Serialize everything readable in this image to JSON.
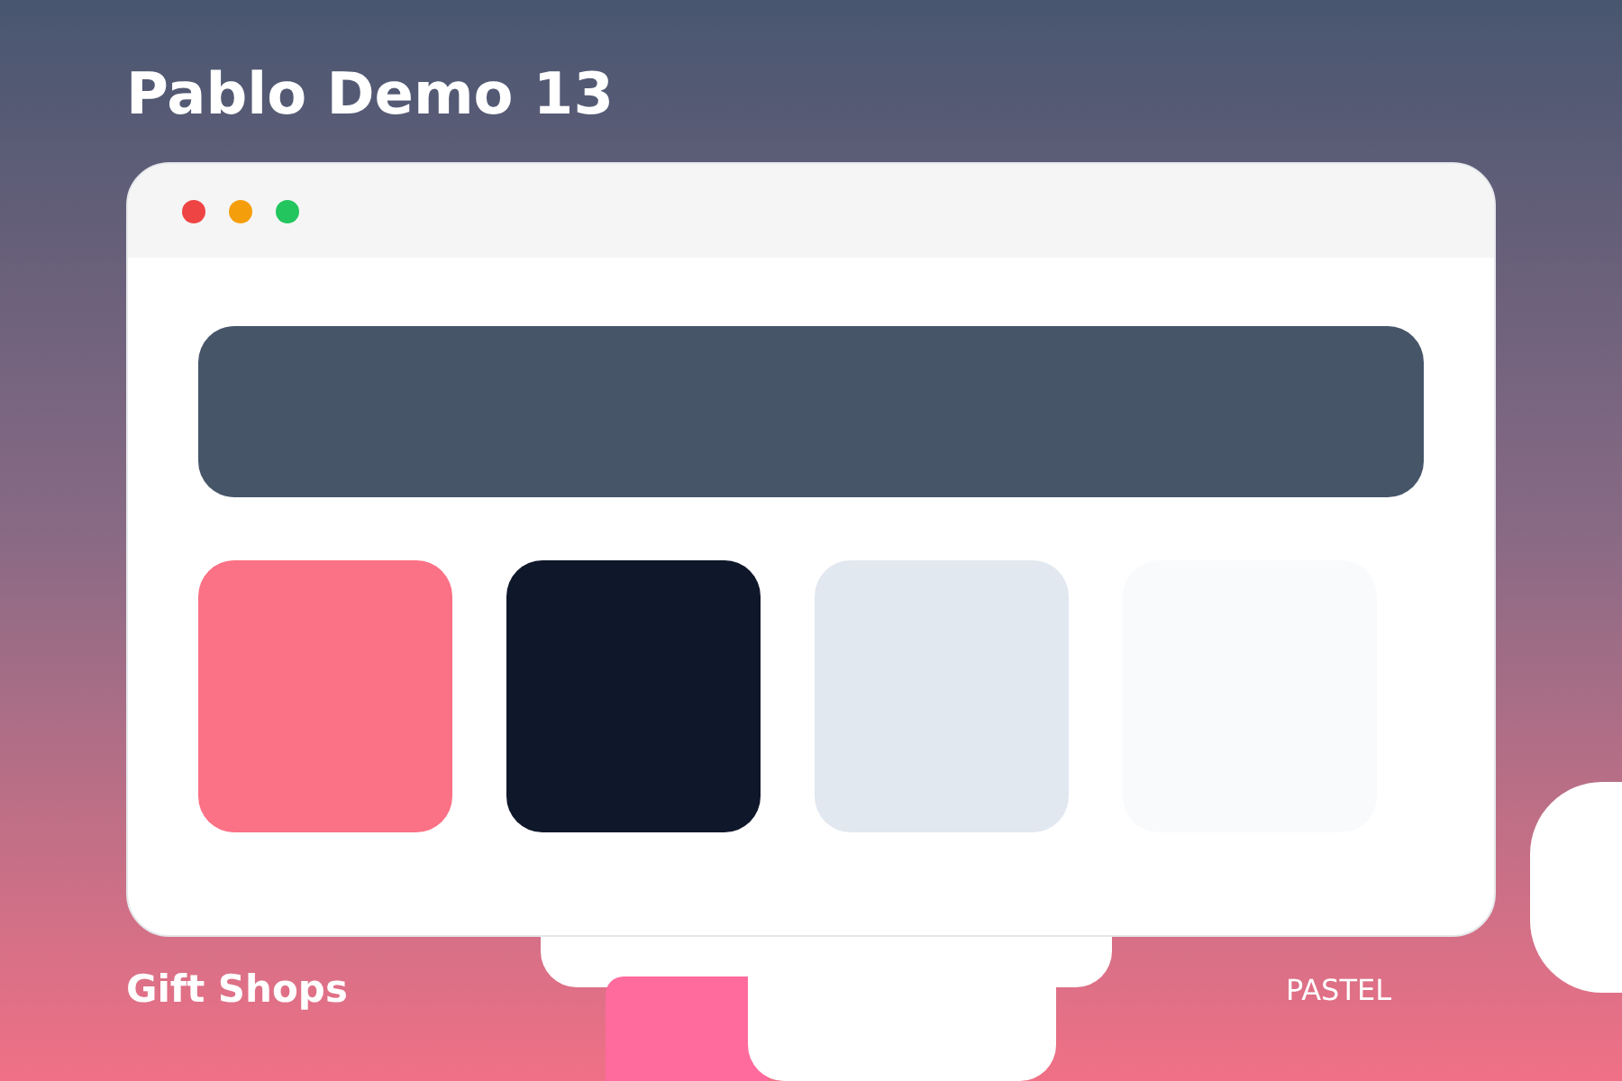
{
  "title": "Pablo Demo 13",
  "palette": [
    {
      "color": "#fb7185"
    },
    {
      "color": "#0f172a"
    },
    {
      "color": "#e2e8f0"
    },
    {
      "color": "#f8fafc"
    }
  ],
  "footer": {
    "category": "Gift Shops",
    "style": "PASTEL"
  }
}
